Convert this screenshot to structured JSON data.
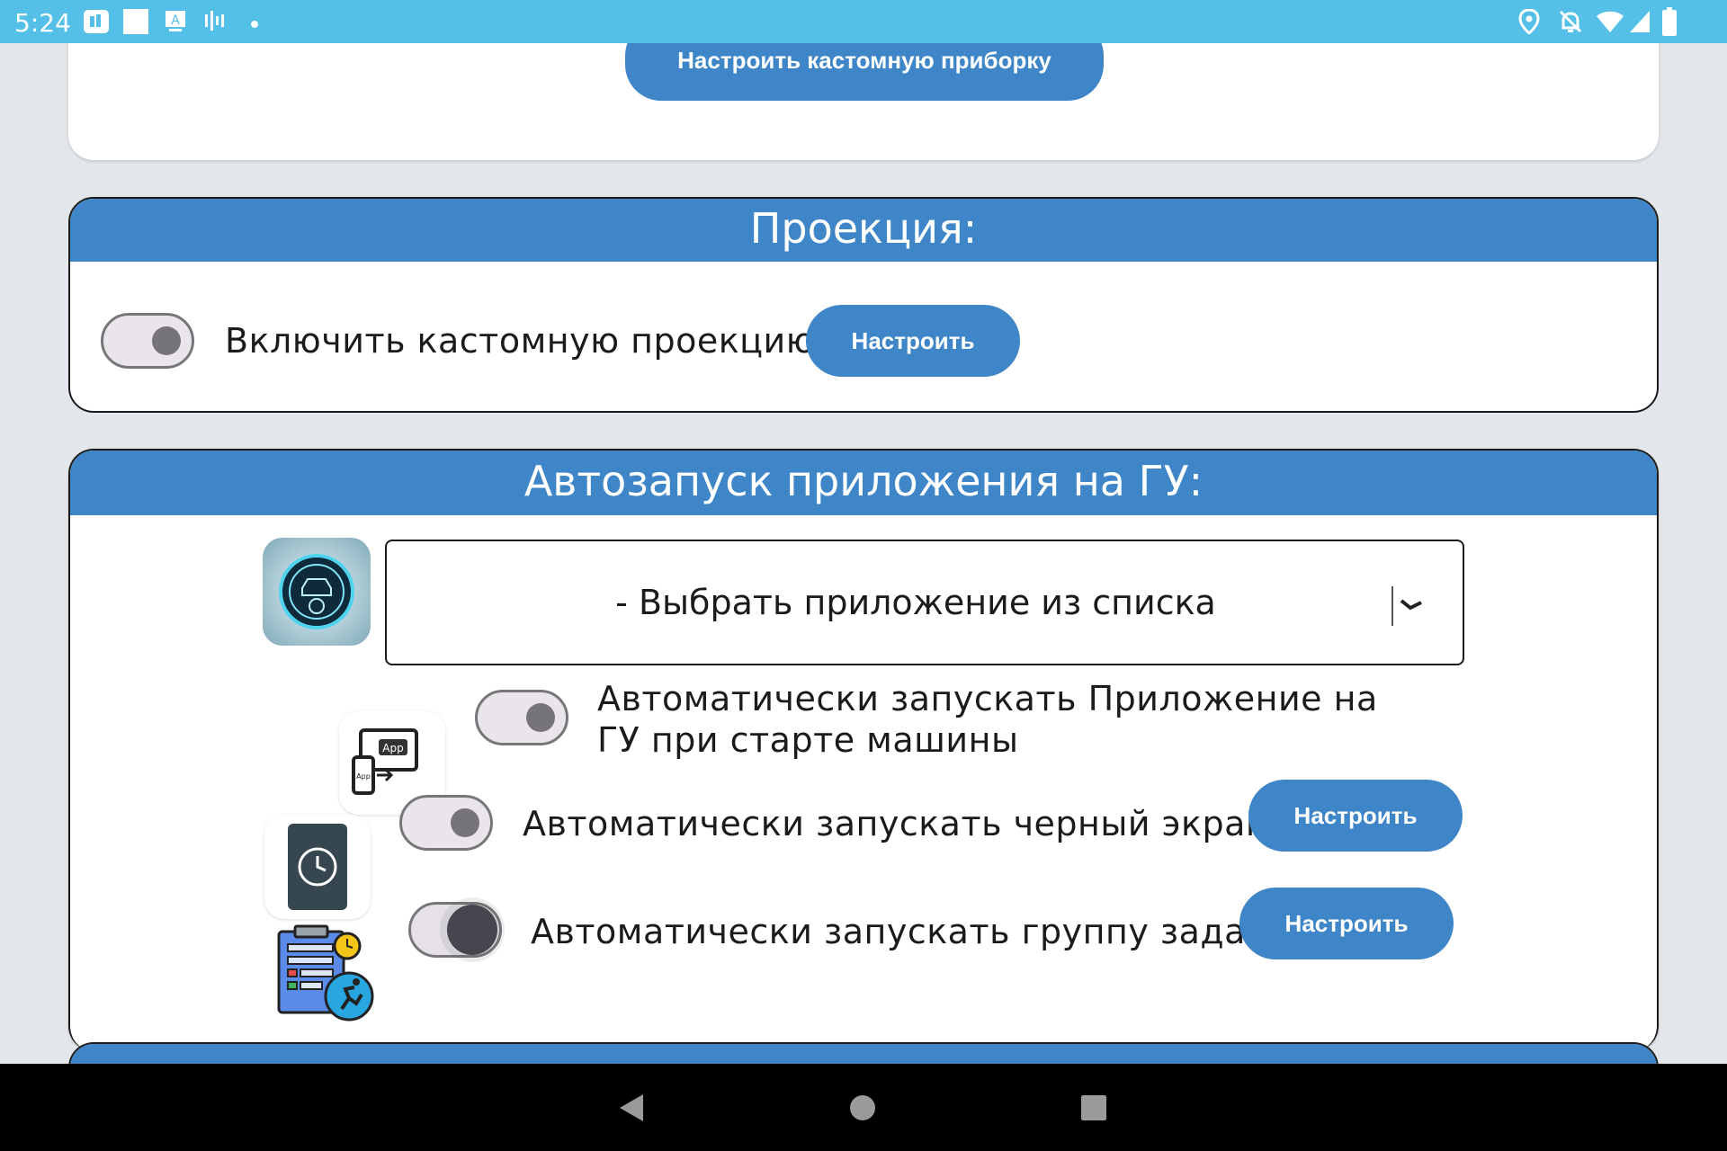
{
  "status_bar": {
    "time": "5:24",
    "left_icons": [
      "photos-icon",
      "square-icon",
      "keyboard-a-icon",
      "signal-bars-icon",
      "dot-icon"
    ],
    "right_icons": [
      "location-icon",
      "notifications-off-icon",
      "wifi-icon",
      "cell-signal-icon",
      "battery-icon"
    ]
  },
  "prev_card": {
    "button_label": "Настроить кастомную приборку"
  },
  "projection": {
    "title": "Проекция:",
    "toggle_label": "Включить кастомную проекцию",
    "toggle_on": false,
    "button_label": "Настроить"
  },
  "autostart": {
    "title": "Автозапуск приложения на ГУ:",
    "dropdown_value": "- Выбрать приложение из списка",
    "rows": [
      {
        "label_line1": "Автоматически запускать Приложение на",
        "label_line2": "ГУ при старте машины",
        "toggle_on": false,
        "icon": "app-to-screen-icon"
      },
      {
        "label": "Автоматически запускать черный экран",
        "toggle_on": false,
        "button_label": "Настроить",
        "icon": "black-screen-clock-icon"
      },
      {
        "label": "Автоматически запускать группу задач",
        "toggle_on": true,
        "button_label": "Настроить",
        "icon": "task-group-icon"
      }
    ]
  },
  "nav_bar": {
    "icons": [
      "back-icon",
      "home-icon",
      "recents-icon"
    ]
  },
  "colors": {
    "accent": "#3f86c8",
    "status_bar": "#54c0e8",
    "background": "#e3e6ea"
  }
}
